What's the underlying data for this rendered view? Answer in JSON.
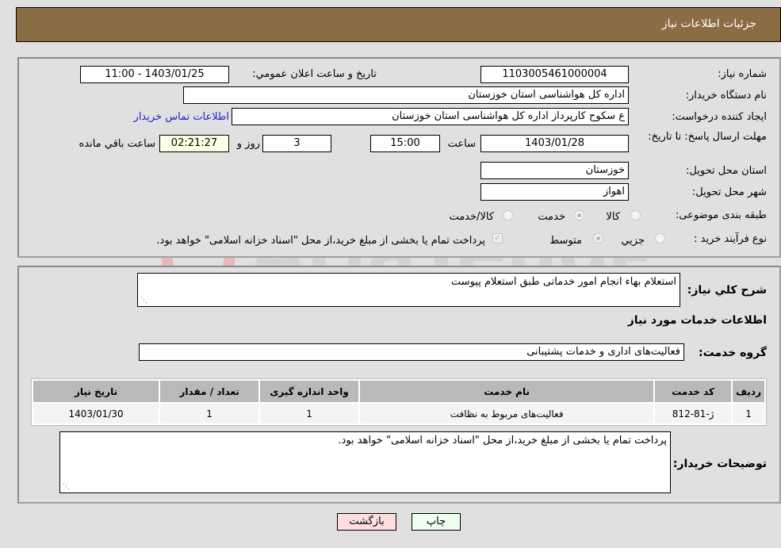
{
  "header": {
    "title": "جزئیات اطلاعات نیاز"
  },
  "fields": {
    "need_number": {
      "label": "شماره نیاز:",
      "value": "1103005461000004"
    },
    "announce_datetime": {
      "label": "تاریخ و ساعت اعلان عمومي:",
      "value": "1403/01/25 - 11:00"
    },
    "buyer_org": {
      "label": "نام دستگاه خریدار:",
      "value": "اداره کل هواشناسی استان خوزستان"
    },
    "requester": {
      "label": "ایجاد کننده درخواست:",
      "value": "ع سکوح کارپرداز اداره کل هواشناسی استان خوزستان"
    },
    "buyer_contact_link": "اطلاعات تماس خریدار",
    "deadline": {
      "label": "مهلت ارسال پاسخ: تا تاریخ:",
      "date": "1403/01/28",
      "time_label": "ساعت",
      "time": "15:00",
      "days": "3",
      "days_label": "روز و",
      "remaining": "02:21:27",
      "remaining_label": "ساعت باقي مانده"
    },
    "delivery_province": {
      "label": "استان محل تحویل:",
      "value": "خوزستان"
    },
    "delivery_city": {
      "label": "شهر محل تحویل:",
      "value": "اهواز"
    },
    "category": {
      "label": "طبقه بندی موضوعی:",
      "options": [
        "کالا",
        "خدمت",
        "کالا/خدمت"
      ],
      "selected": "خدمت"
    },
    "purchase_type": {
      "label": "نوع فرآیند خرید :",
      "options": [
        "جزیي",
        "متوسط"
      ],
      "selected": "متوسط",
      "treasury_note": "پرداخت تمام یا بخشی از مبلغ خرید،از محل \"اسناد خزانه اسلامی\" خواهد بود."
    }
  },
  "description": {
    "label": "شرح کلي نیاز:",
    "value": "استعلام بهاء انجام امور خدماتی طبق استعلام پیوست"
  },
  "services_section": {
    "title": "اطلاعات خدمات مورد نیاز",
    "group_label": "گروه خدمت:",
    "group_value": "فعالیت‌های اداری و خدمات پشتیبانی"
  },
  "table": {
    "headers": [
      "ردیف",
      "کد خدمت",
      "نام خدمت",
      "واحد اندازه گیری",
      "تعداد / مقدار",
      "تاریخ نیاز"
    ],
    "rows": [
      [
        "1",
        "ژ-81-812",
        "فعالیت‌های مربوط به نظافت",
        "1",
        "1",
        "1403/01/30"
      ]
    ]
  },
  "buyer_notes": {
    "label": "توضیحات خریدار:",
    "value": "پرداخت تمام یا بخشی از مبلغ خرید،از محل \"اسناد خزانه اسلامی\" خواهد بود."
  },
  "buttons": {
    "print": "چاپ",
    "back": "بازگشت"
  },
  "watermark": "AriaTender.neT"
}
